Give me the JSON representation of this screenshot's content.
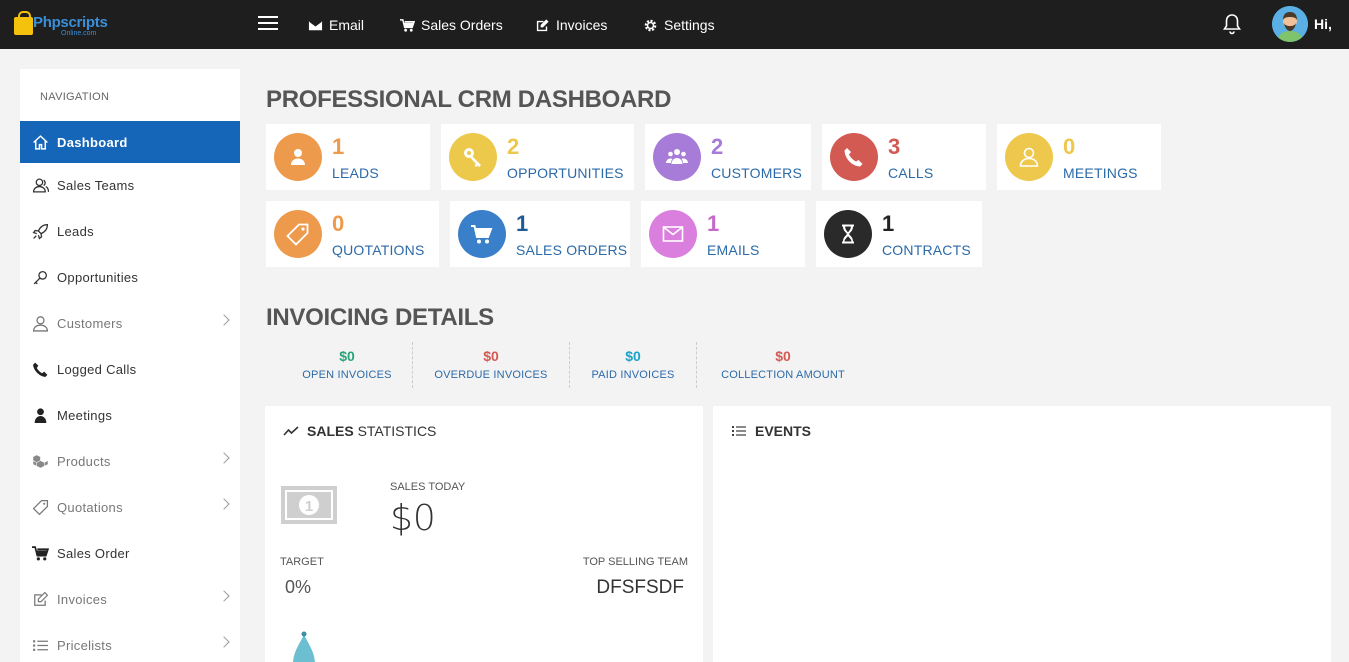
{
  "topbar": {
    "logo_text": "Phpscripts",
    "logo_sub": "Online.com",
    "links": [
      {
        "label": "Email",
        "icon": "envelope-icon"
      },
      {
        "label": "Sales Orders",
        "icon": "cart-icon"
      },
      {
        "label": "Invoices",
        "icon": "edit-icon"
      },
      {
        "label": "Settings",
        "icon": "gear-icon"
      }
    ],
    "greeting": "Hi,"
  },
  "sidebar": {
    "heading": "NAVIGATION",
    "items": [
      {
        "label": "Dashboard",
        "icon": "home-icon",
        "active": true
      },
      {
        "label": "Sales Teams",
        "icon": "users-icon"
      },
      {
        "label": "Leads",
        "icon": "rocket-icon"
      },
      {
        "label": "Opportunities",
        "icon": "key-icon"
      },
      {
        "label": "Customers",
        "icon": "user-icon",
        "submenu": true
      },
      {
        "label": "Logged Calls",
        "icon": "phone-icon"
      },
      {
        "label": "Meetings",
        "icon": "person-icon"
      },
      {
        "label": "Products",
        "icon": "cubes-icon",
        "submenu": true
      },
      {
        "label": "Quotations",
        "icon": "tag-icon",
        "submenu": true
      },
      {
        "label": "Sales Order",
        "icon": "cart-icon"
      },
      {
        "label": "Invoices",
        "icon": "edit-icon",
        "submenu": true
      },
      {
        "label": "Pricelists",
        "icon": "list-icon",
        "submenu": true
      }
    ]
  },
  "main": {
    "title": "PROFESSIONAL CRM DASHBOARD",
    "cards": [
      {
        "count": "1",
        "label": "LEADS",
        "color": "#ee9a4d",
        "icon": "user-icon"
      },
      {
        "count": "2",
        "label": "OPPORTUNITIES",
        "color": "#ecc84b",
        "icon": "key-icon"
      },
      {
        "count": "2",
        "label": "CUSTOMERS",
        "color": "#a77cd9",
        "icon": "users-icon"
      },
      {
        "count": "3",
        "label": "CALLS",
        "color": "#d35a53",
        "icon": "phone-icon"
      },
      {
        "count": "0",
        "label": "MEETINGS",
        "color": "#edc84c",
        "icon": "user-outline-icon"
      },
      {
        "count": "0",
        "label": "QUOTATIONS",
        "color": "#ee9a4d",
        "icon": "tag-icon"
      },
      {
        "count": "1",
        "label": "SALES ORDERS",
        "color": "#3a7fc9",
        "icon": "cart-icon"
      },
      {
        "count": "1",
        "label": "EMAILS",
        "color": "#db7fdf",
        "icon": "envelope-icon"
      },
      {
        "count": "1",
        "label": "CONTRACTS",
        "color": "#2a2a2a",
        "icon": "hourglass-icon"
      }
    ],
    "invoicing": {
      "title": "INVOICING DETAILS",
      "items": [
        {
          "value": "$0",
          "label": "OPEN INVOICES",
          "color": "#2aa37a"
        },
        {
          "value": "$0",
          "label": "OVERDUE INVOICES",
          "color": "#d35a53"
        },
        {
          "value": "$0",
          "label": "PAID INVOICES",
          "color": "#1aa3c8"
        },
        {
          "value": "$0",
          "label": "COLLECTION AMOUNT",
          "color": "#d35a53"
        }
      ]
    },
    "sales_statistics": {
      "title_bold": "SALES",
      "title_rest": "STATISTICS",
      "sales_today_label": "SALES TODAY",
      "sales_today_value": "$0",
      "target_label": "TARGET",
      "target_value": "0%",
      "top_team_label": "TOP SELLING TEAM",
      "top_team_value": "DFSFSDF"
    },
    "events": {
      "title": "EVENTS"
    }
  }
}
